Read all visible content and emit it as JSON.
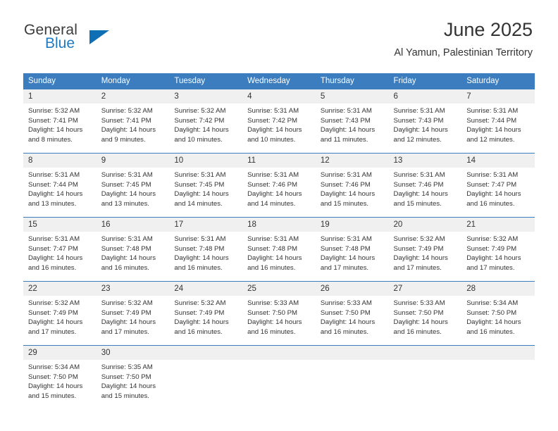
{
  "logo": {
    "word_top": "General",
    "word_bottom": "Blue",
    "triangle_color": "#0f6fb5",
    "blue_text_color": "#1f7ac0"
  },
  "header": {
    "title": "June 2025",
    "subtitle": "Al Yamun, Palestinian Territory"
  },
  "theme": {
    "header_blue": "#3b7dbf",
    "daynum_bg": "#f0f0f0",
    "text": "#333333"
  },
  "calendar": {
    "weekday_headers": [
      "Sunday",
      "Monday",
      "Tuesday",
      "Wednesday",
      "Thursday",
      "Friday",
      "Saturday"
    ],
    "weeks": [
      [
        {
          "day": "1",
          "sunrise": "Sunrise: 5:32 AM",
          "sunset": "Sunset: 7:41 PM",
          "daylight_line1": "Daylight: 14 hours",
          "daylight_line2": "and 8 minutes."
        },
        {
          "day": "2",
          "sunrise": "Sunrise: 5:32 AM",
          "sunset": "Sunset: 7:41 PM",
          "daylight_line1": "Daylight: 14 hours",
          "daylight_line2": "and 9 minutes."
        },
        {
          "day": "3",
          "sunrise": "Sunrise: 5:32 AM",
          "sunset": "Sunset: 7:42 PM",
          "daylight_line1": "Daylight: 14 hours",
          "daylight_line2": "and 10 minutes."
        },
        {
          "day": "4",
          "sunrise": "Sunrise: 5:31 AM",
          "sunset": "Sunset: 7:42 PM",
          "daylight_line1": "Daylight: 14 hours",
          "daylight_line2": "and 10 minutes."
        },
        {
          "day": "5",
          "sunrise": "Sunrise: 5:31 AM",
          "sunset": "Sunset: 7:43 PM",
          "daylight_line1": "Daylight: 14 hours",
          "daylight_line2": "and 11 minutes."
        },
        {
          "day": "6",
          "sunrise": "Sunrise: 5:31 AM",
          "sunset": "Sunset: 7:43 PM",
          "daylight_line1": "Daylight: 14 hours",
          "daylight_line2": "and 12 minutes."
        },
        {
          "day": "7",
          "sunrise": "Sunrise: 5:31 AM",
          "sunset": "Sunset: 7:44 PM",
          "daylight_line1": "Daylight: 14 hours",
          "daylight_line2": "and 12 minutes."
        }
      ],
      [
        {
          "day": "8",
          "sunrise": "Sunrise: 5:31 AM",
          "sunset": "Sunset: 7:44 PM",
          "daylight_line1": "Daylight: 14 hours",
          "daylight_line2": "and 13 minutes."
        },
        {
          "day": "9",
          "sunrise": "Sunrise: 5:31 AM",
          "sunset": "Sunset: 7:45 PM",
          "daylight_line1": "Daylight: 14 hours",
          "daylight_line2": "and 13 minutes."
        },
        {
          "day": "10",
          "sunrise": "Sunrise: 5:31 AM",
          "sunset": "Sunset: 7:45 PM",
          "daylight_line1": "Daylight: 14 hours",
          "daylight_line2": "and 14 minutes."
        },
        {
          "day": "11",
          "sunrise": "Sunrise: 5:31 AM",
          "sunset": "Sunset: 7:46 PM",
          "daylight_line1": "Daylight: 14 hours",
          "daylight_line2": "and 14 minutes."
        },
        {
          "day": "12",
          "sunrise": "Sunrise: 5:31 AM",
          "sunset": "Sunset: 7:46 PM",
          "daylight_line1": "Daylight: 14 hours",
          "daylight_line2": "and 15 minutes."
        },
        {
          "day": "13",
          "sunrise": "Sunrise: 5:31 AM",
          "sunset": "Sunset: 7:46 PM",
          "daylight_line1": "Daylight: 14 hours",
          "daylight_line2": "and 15 minutes."
        },
        {
          "day": "14",
          "sunrise": "Sunrise: 5:31 AM",
          "sunset": "Sunset: 7:47 PM",
          "daylight_line1": "Daylight: 14 hours",
          "daylight_line2": "and 16 minutes."
        }
      ],
      [
        {
          "day": "15",
          "sunrise": "Sunrise: 5:31 AM",
          "sunset": "Sunset: 7:47 PM",
          "daylight_line1": "Daylight: 14 hours",
          "daylight_line2": "and 16 minutes."
        },
        {
          "day": "16",
          "sunrise": "Sunrise: 5:31 AM",
          "sunset": "Sunset: 7:48 PM",
          "daylight_line1": "Daylight: 14 hours",
          "daylight_line2": "and 16 minutes."
        },
        {
          "day": "17",
          "sunrise": "Sunrise: 5:31 AM",
          "sunset": "Sunset: 7:48 PM",
          "daylight_line1": "Daylight: 14 hours",
          "daylight_line2": "and 16 minutes."
        },
        {
          "day": "18",
          "sunrise": "Sunrise: 5:31 AM",
          "sunset": "Sunset: 7:48 PM",
          "daylight_line1": "Daylight: 14 hours",
          "daylight_line2": "and 16 minutes."
        },
        {
          "day": "19",
          "sunrise": "Sunrise: 5:31 AM",
          "sunset": "Sunset: 7:48 PM",
          "daylight_line1": "Daylight: 14 hours",
          "daylight_line2": "and 17 minutes."
        },
        {
          "day": "20",
          "sunrise": "Sunrise: 5:32 AM",
          "sunset": "Sunset: 7:49 PM",
          "daylight_line1": "Daylight: 14 hours",
          "daylight_line2": "and 17 minutes."
        },
        {
          "day": "21",
          "sunrise": "Sunrise: 5:32 AM",
          "sunset": "Sunset: 7:49 PM",
          "daylight_line1": "Daylight: 14 hours",
          "daylight_line2": "and 17 minutes."
        }
      ],
      [
        {
          "day": "22",
          "sunrise": "Sunrise: 5:32 AM",
          "sunset": "Sunset: 7:49 PM",
          "daylight_line1": "Daylight: 14 hours",
          "daylight_line2": "and 17 minutes."
        },
        {
          "day": "23",
          "sunrise": "Sunrise: 5:32 AM",
          "sunset": "Sunset: 7:49 PM",
          "daylight_line1": "Daylight: 14 hours",
          "daylight_line2": "and 17 minutes."
        },
        {
          "day": "24",
          "sunrise": "Sunrise: 5:32 AM",
          "sunset": "Sunset: 7:49 PM",
          "daylight_line1": "Daylight: 14 hours",
          "daylight_line2": "and 16 minutes."
        },
        {
          "day": "25",
          "sunrise": "Sunrise: 5:33 AM",
          "sunset": "Sunset: 7:50 PM",
          "daylight_line1": "Daylight: 14 hours",
          "daylight_line2": "and 16 minutes."
        },
        {
          "day": "26",
          "sunrise": "Sunrise: 5:33 AM",
          "sunset": "Sunset: 7:50 PM",
          "daylight_line1": "Daylight: 14 hours",
          "daylight_line2": "and 16 minutes."
        },
        {
          "day": "27",
          "sunrise": "Sunrise: 5:33 AM",
          "sunset": "Sunset: 7:50 PM",
          "daylight_line1": "Daylight: 14 hours",
          "daylight_line2": "and 16 minutes."
        },
        {
          "day": "28",
          "sunrise": "Sunrise: 5:34 AM",
          "sunset": "Sunset: 7:50 PM",
          "daylight_line1": "Daylight: 14 hours",
          "daylight_line2": "and 16 minutes."
        }
      ],
      [
        {
          "day": "29",
          "sunrise": "Sunrise: 5:34 AM",
          "sunset": "Sunset: 7:50 PM",
          "daylight_line1": "Daylight: 14 hours",
          "daylight_line2": "and 15 minutes."
        },
        {
          "day": "30",
          "sunrise": "Sunrise: 5:35 AM",
          "sunset": "Sunset: 7:50 PM",
          "daylight_line1": "Daylight: 14 hours",
          "daylight_line2": "and 15 minutes."
        },
        {
          "day": "",
          "sunrise": "",
          "sunset": "",
          "daylight_line1": "",
          "daylight_line2": ""
        },
        {
          "day": "",
          "sunrise": "",
          "sunset": "",
          "daylight_line1": "",
          "daylight_line2": ""
        },
        {
          "day": "",
          "sunrise": "",
          "sunset": "",
          "daylight_line1": "",
          "daylight_line2": ""
        },
        {
          "day": "",
          "sunrise": "",
          "sunset": "",
          "daylight_line1": "",
          "daylight_line2": ""
        },
        {
          "day": "",
          "sunrise": "",
          "sunset": "",
          "daylight_line1": "",
          "daylight_line2": ""
        }
      ]
    ]
  }
}
